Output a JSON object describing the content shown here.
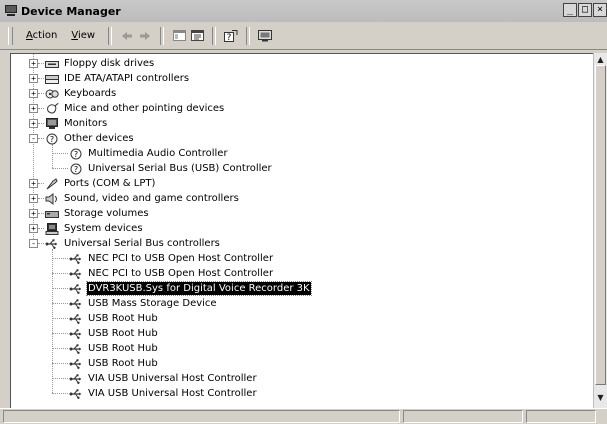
{
  "window": {
    "title": "Device Manager",
    "controls": [
      "_",
      "□",
      "×"
    ]
  },
  "menu": [
    {
      "label": "Action",
      "accel": "A",
      "rest": "ction"
    },
    {
      "label": "View",
      "accel": "V",
      "rest": "iew"
    }
  ],
  "toolbar_icons": [
    "back-arrow-icon",
    "forward-arrow-icon",
    "show-hide-tree-icon",
    "properties-icon",
    "help-icon",
    "scan-hardware-icon"
  ],
  "tree": [
    {
      "label": "Floppy disk drives",
      "level": 0,
      "expander": "+",
      "icon": "floppy-drive-icon"
    },
    {
      "label": "IDE ATA/ATAPI controllers",
      "level": 0,
      "expander": "+",
      "icon": "ide-controller-icon"
    },
    {
      "label": "Keyboards",
      "level": 0,
      "expander": "+",
      "icon": "keyboard-icon"
    },
    {
      "label": "Mice and other pointing devices",
      "level": 0,
      "expander": "+",
      "icon": "mouse-icon"
    },
    {
      "label": "Monitors",
      "level": 0,
      "expander": "+",
      "icon": "monitor-icon"
    },
    {
      "label": "Other devices",
      "level": 0,
      "expander": "-",
      "icon": "unknown-device-icon"
    },
    {
      "label": "Multimedia Audio Controller",
      "level": 1,
      "icon": "unknown-device-icon"
    },
    {
      "label": "Universal Serial Bus (USB) Controller",
      "level": 1,
      "icon": "unknown-device-icon"
    },
    {
      "label": "Ports (COM & LPT)",
      "level": 0,
      "expander": "+",
      "icon": "port-icon"
    },
    {
      "label": "Sound, video and game controllers",
      "level": 0,
      "expander": "+",
      "icon": "sound-icon"
    },
    {
      "label": "Storage volumes",
      "level": 0,
      "expander": "+",
      "icon": "storage-volume-icon"
    },
    {
      "label": "System devices",
      "level": 0,
      "expander": "+",
      "icon": "system-device-icon"
    },
    {
      "label": "Universal Serial Bus controllers",
      "level": 0,
      "expander": "-",
      "icon": "usb-icon"
    },
    {
      "label": "NEC PCI to USB Open Host Controller",
      "level": 1,
      "icon": "usb-icon"
    },
    {
      "label": "NEC PCI to USB Open Host Controller",
      "level": 1,
      "icon": "usb-icon"
    },
    {
      "label": "DVR3KUSB.Sys for Digital Voice Recorder 3K",
      "level": 1,
      "icon": "usb-icon",
      "selected": true
    },
    {
      "label": "USB Mass Storage Device",
      "level": 1,
      "icon": "usb-icon"
    },
    {
      "label": "USB Root Hub",
      "level": 1,
      "icon": "usb-icon"
    },
    {
      "label": "USB Root Hub",
      "level": 1,
      "icon": "usb-icon"
    },
    {
      "label": "USB Root Hub",
      "level": 1,
      "icon": "usb-icon"
    },
    {
      "label": "USB Root Hub",
      "level": 1,
      "icon": "usb-icon"
    },
    {
      "label": "VIA USB Universal Host Controller",
      "level": 1,
      "icon": "usb-icon"
    },
    {
      "label": "VIA USB Universal Host Controller",
      "level": 1,
      "icon": "usb-icon"
    }
  ],
  "colors": {
    "selection_bg": "#000000",
    "selection_fg": "#ffffff",
    "window_bg": "#d4d0c8"
  }
}
